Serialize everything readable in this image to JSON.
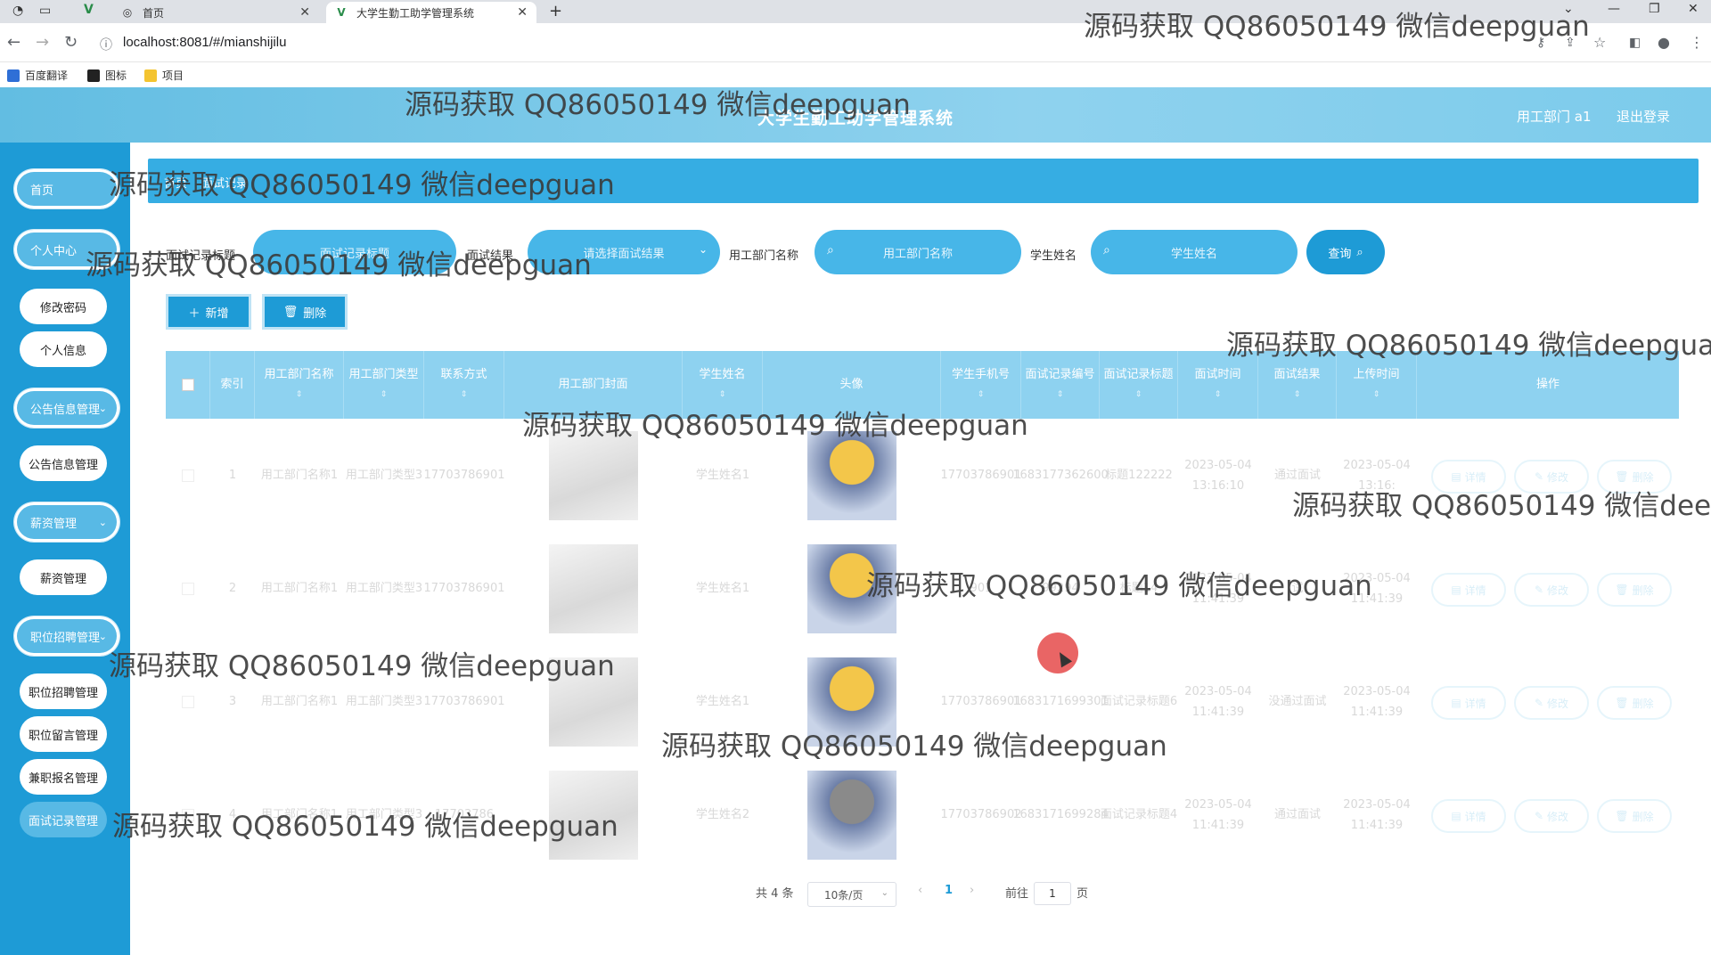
{
  "browser": {
    "tabs": [
      {
        "label": "首页",
        "active": false
      },
      {
        "label": "大学生勤工助学管理系统",
        "active": true
      }
    ],
    "new_tab_label": "+",
    "url": "localhost:8081/#/mianshijilu",
    "bookmarks": [
      "百度翻译",
      "图标",
      "项目"
    ]
  },
  "header": {
    "title": "大学生勤工助学管理系统",
    "user": "用工部门 a1",
    "logout": "退出登录"
  },
  "sidebar": {
    "items": [
      {
        "label": "首页",
        "type": "pill"
      },
      {
        "label": "个人中心",
        "type": "pill"
      },
      {
        "label": "修改密码",
        "type": "sub"
      },
      {
        "label": "个人信息",
        "type": "sub"
      },
      {
        "label": "公告信息管理",
        "type": "pill"
      },
      {
        "label": "公告信息管理",
        "type": "sub"
      },
      {
        "label": "薪资管理",
        "type": "pill"
      },
      {
        "label": "薪资管理",
        "type": "sub"
      },
      {
        "label": "职位招聘管理",
        "type": "pill"
      },
      {
        "label": "职位招聘管理",
        "type": "sub"
      },
      {
        "label": "职位留言管理",
        "type": "sub"
      },
      {
        "label": "兼职报名管理",
        "type": "sub"
      },
      {
        "label": "面试记录管理",
        "type": "sub-active"
      }
    ]
  },
  "breadcrumb": [
    "首页",
    "面试记录"
  ],
  "search": {
    "fields": [
      {
        "label": "面试记录标题",
        "placeholder": "面试记录标题"
      },
      {
        "label": "面试结果",
        "placeholder": "请选择面试结果"
      },
      {
        "label": "用工部门名称",
        "placeholder": "用工部门名称"
      },
      {
        "label": "学生姓名",
        "placeholder": "学生姓名"
      }
    ],
    "button": "查询"
  },
  "actions": {
    "add": "新增",
    "delete": "删除"
  },
  "table": {
    "headers": [
      "索引",
      "用工部门名称",
      "用工部门类型",
      "联系方式",
      "用工部门封面",
      "学生姓名",
      "头像",
      "学生手机号",
      "面试记录编号",
      "面试记录标题",
      "面试时间",
      "面试结果",
      "上传时间",
      "操作"
    ],
    "rows": [
      {
        "index": "1",
        "dept_name": "用工部门名称1",
        "dept_type": "用工部门类型3",
        "contact": "17703786901",
        "student": "学生姓名1",
        "phone": "17703786901",
        "record_no": "1683177362600",
        "title": "标题122222",
        "interview_time": "2023-05-04 13:16:10",
        "result": "通过面试",
        "upload_time": "2023-05-04 13:16:"
      },
      {
        "index": "2",
        "dept_name": "用工部门名称1",
        "dept_type": "用工部门类型3",
        "contact": "17703786901",
        "student": "学生姓名1",
        "phone": "901",
        "record_no": "99294",
        "title": "标题14",
        "interview_time": "2023-05-04 11:41:39",
        "result": "试",
        "upload_time": "2023-05-04 11:41:39"
      },
      {
        "index": "3",
        "dept_name": "用工部门名称1",
        "dept_type": "用工部门类型3",
        "contact": "17703786901",
        "student": "学生姓名1",
        "phone": "17703786901",
        "record_no": "1683171699301",
        "title": "面试记录标题6",
        "interview_time": "2023-05-04 11:41:39",
        "result": "没通过面试",
        "upload_time": "2023-05-04 11:41:39"
      },
      {
        "index": "4",
        "dept_name": "用工部门名称1",
        "dept_type": "用工部门类型3",
        "contact": "17703786",
        "student": "学生姓名2",
        "phone": "17703786902",
        "record_no": "1683171699284",
        "title": "面试记录标题4",
        "interview_time": "2023-05-04 11:41:39",
        "result": "通过面试",
        "upload_time": "2023-05-04 11:41:39"
      }
    ],
    "op_labels": [
      "详情",
      "修改",
      "删除"
    ]
  },
  "pagination": {
    "total": "共 4 条",
    "page_size": "10条/页",
    "current_page": "1",
    "goto_prefix": "前往",
    "goto_value": "1",
    "goto_suffix": "页"
  },
  "watermark": "源码获取 QQ86050149 微信deepguan",
  "colors": {
    "primary": "#1e9bd6",
    "header": "#62bde2",
    "table_header": "#8ed2f0"
  }
}
